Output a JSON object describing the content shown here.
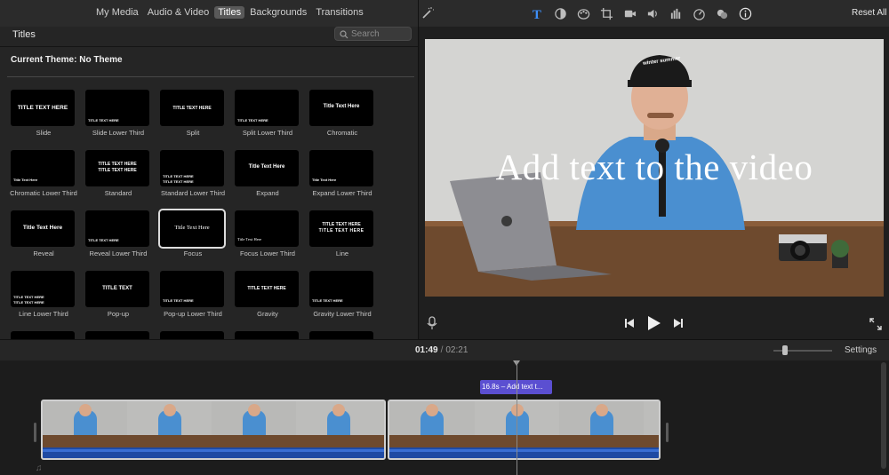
{
  "library_tabs": [
    "My Media",
    "Audio & Video",
    "Titles",
    "Backgrounds",
    "Transitions"
  ],
  "active_tab": "Titles",
  "adjust_toolbar": {
    "icons": [
      "magic-wand-icon",
      "titles-T-icon",
      "color-balance-icon",
      "color-correction-icon",
      "crop-icon",
      "stabilization-icon",
      "volume-icon",
      "equalizer-icon",
      "speed-icon",
      "overlay-icon",
      "info-icon"
    ],
    "accent": "#3d8ef7",
    "reset_label": "Reset All"
  },
  "browser": {
    "title": "Titles",
    "search_placeholder": "Search",
    "theme_label": "Current Theme: No Theme",
    "tiles": [
      {
        "name": "Slide",
        "thumb_text": "TITLE TEXT HERE"
      },
      {
        "name": "Slide Lower Third",
        "thumb_text": "TITLE TEXT HERE"
      },
      {
        "name": "Split",
        "thumb_text": "TITLE TEXT HERE"
      },
      {
        "name": "Split Lower Third",
        "thumb_text": "TITLE TEXT HERE"
      },
      {
        "name": "Chromatic",
        "thumb_text": "Title Text Here"
      },
      {
        "name": "Chromatic Lower Third",
        "thumb_text": "Title Text Here"
      },
      {
        "name": "Standard",
        "thumb_text": "TITLE TEXT HERE"
      },
      {
        "name": "Standard Lower Third",
        "thumb_text": "TITLE TEXT HERE"
      },
      {
        "name": "Expand",
        "thumb_text": "Title Text Here"
      },
      {
        "name": "Expand Lower Third",
        "thumb_text": "Title Text Here"
      },
      {
        "name": "Reveal",
        "thumb_text": "Title Text Here"
      },
      {
        "name": "Reveal Lower Third",
        "thumb_text": "TITLE TEXT HERE"
      },
      {
        "name": "Focus",
        "thumb_text": "Title Text Here"
      },
      {
        "name": "Focus Lower Third",
        "thumb_text": "Title Text Here"
      },
      {
        "name": "Line",
        "thumb_text": "TITLE TEXT HERE"
      },
      {
        "name": "Line Lower Third",
        "thumb_text": "TITLE TEXT HERE"
      },
      {
        "name": "Pop-up",
        "thumb_text": "TITLE TEXT"
      },
      {
        "name": "Pop-up Lower Third",
        "thumb_text": "TITLE TEXT HERE"
      },
      {
        "name": "Gravity",
        "thumb_text": "TITLE TEXT HERE"
      },
      {
        "name": "Gravity Lower Third",
        "thumb_text": "TITLE TEXT HERE"
      }
    ],
    "selected": "Focus"
  },
  "viewer": {
    "overlay_title": "Add text to the video",
    "cap_text": "winter summer"
  },
  "playback": {
    "current_time": "01:49",
    "separator": "/",
    "total_time": "02:21",
    "settings_label": "Settings"
  },
  "timeline": {
    "title_clip_label": "16.8s – Add text t..."
  }
}
